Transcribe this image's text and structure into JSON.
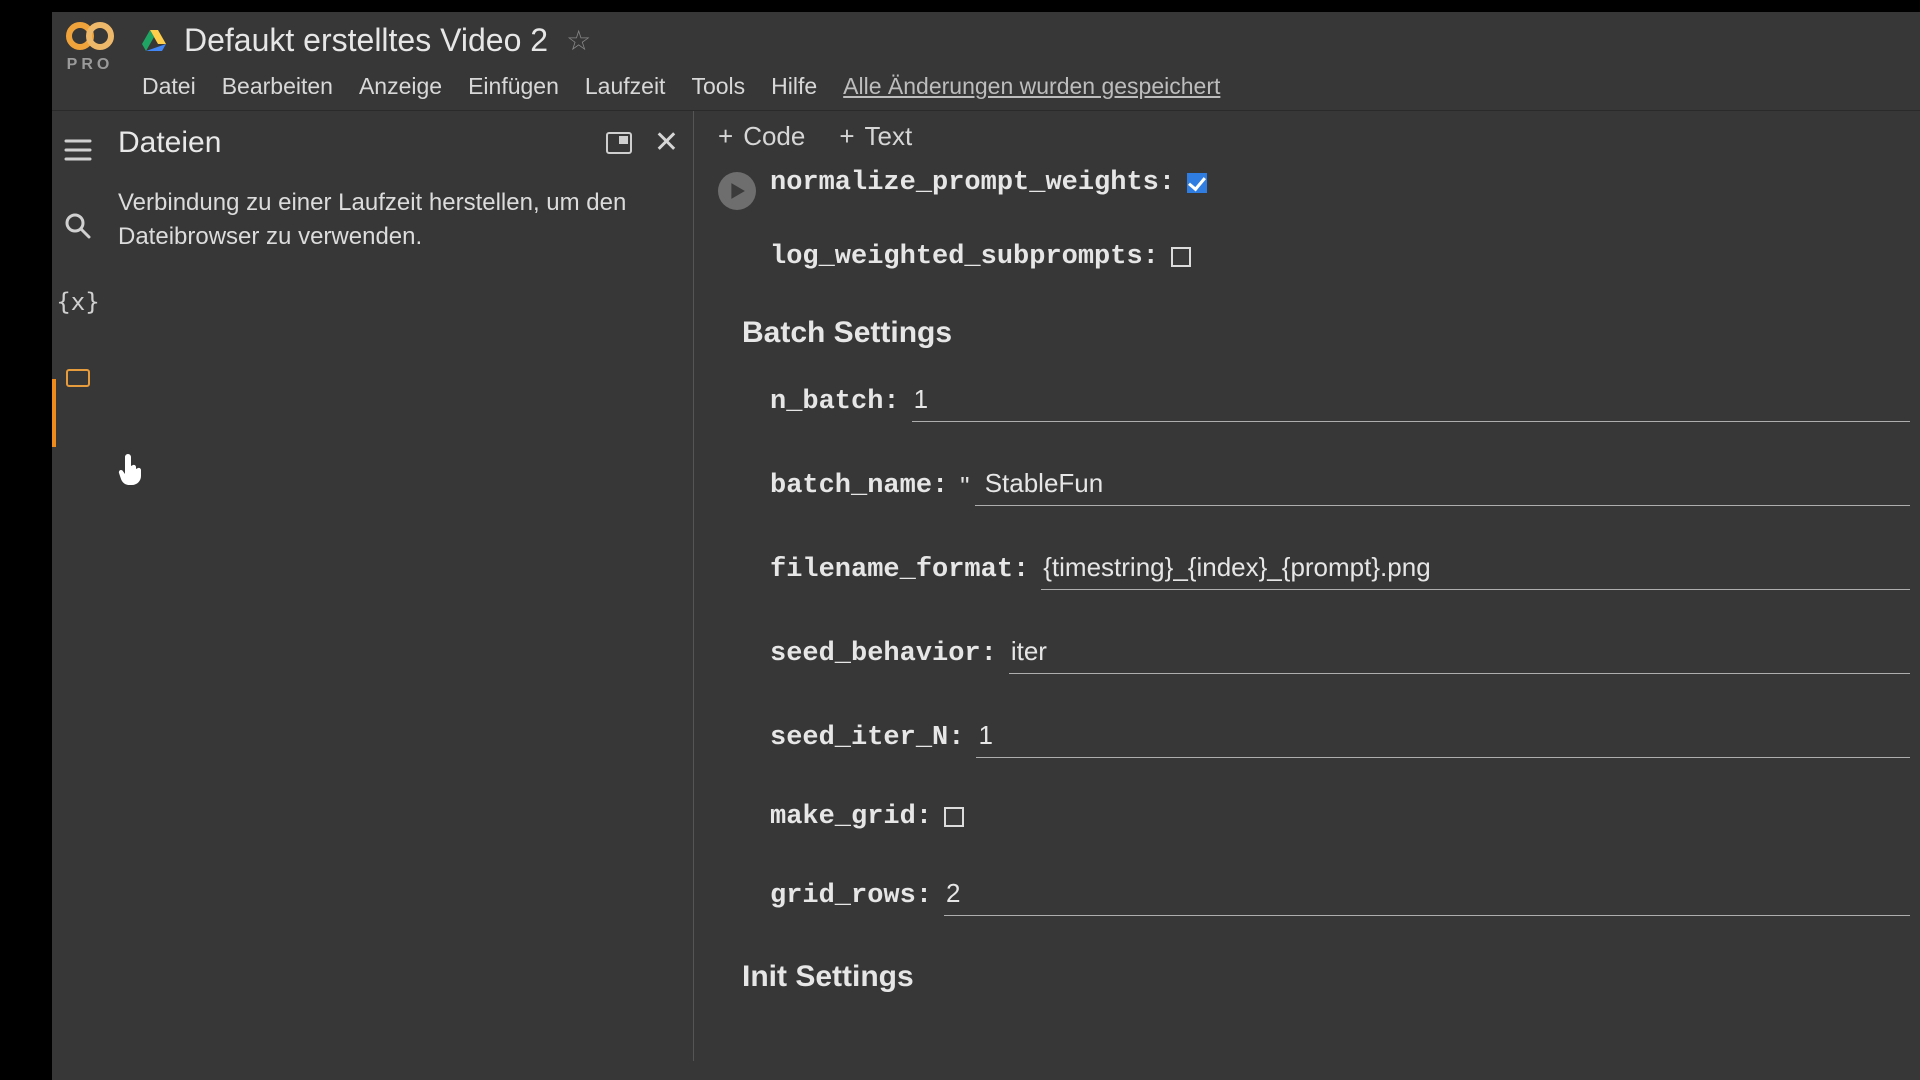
{
  "header": {
    "logo_sub": "PRO",
    "doc_title": "Defaukt erstelltes Video 2",
    "menu": {
      "file": "Datei",
      "edit": "Bearbeiten",
      "view": "Anzeige",
      "insert": "Einfügen",
      "runtime": "Laufzeit",
      "tools": "Tools",
      "help": "Hilfe",
      "saved": "Alle Änderungen wurden gespeichert"
    }
  },
  "sidebar": {
    "title": "Dateien",
    "message": "Verbindung zu einer Laufzeit herstellen, um den Dateibrowser zu verwenden."
  },
  "toolbar": {
    "code": "Code",
    "text": "Text"
  },
  "form": {
    "normalize_label": "normalize_prompt_weights:",
    "normalize_checked": true,
    "log_label": "log_weighted_subprompts:",
    "log_checked": false,
    "section_batch": "Batch Settings",
    "n_batch_label": "n_batch:",
    "n_batch_value": "1",
    "batch_name_label": "batch_name:",
    "batch_name_value": " StableFun",
    "filename_format_label": "filename_format:",
    "filename_format_value": "{timestring}_{index}_{prompt}.png",
    "seed_behavior_label": "seed_behavior:",
    "seed_behavior_value": "iter",
    "seed_iter_n_label": "seed_iter_N:",
    "seed_iter_n_value": "1",
    "make_grid_label": "make_grid:",
    "make_grid_checked": false,
    "grid_rows_label": "grid_rows:",
    "grid_rows_value": "2",
    "section_init": "Init Settings"
  }
}
